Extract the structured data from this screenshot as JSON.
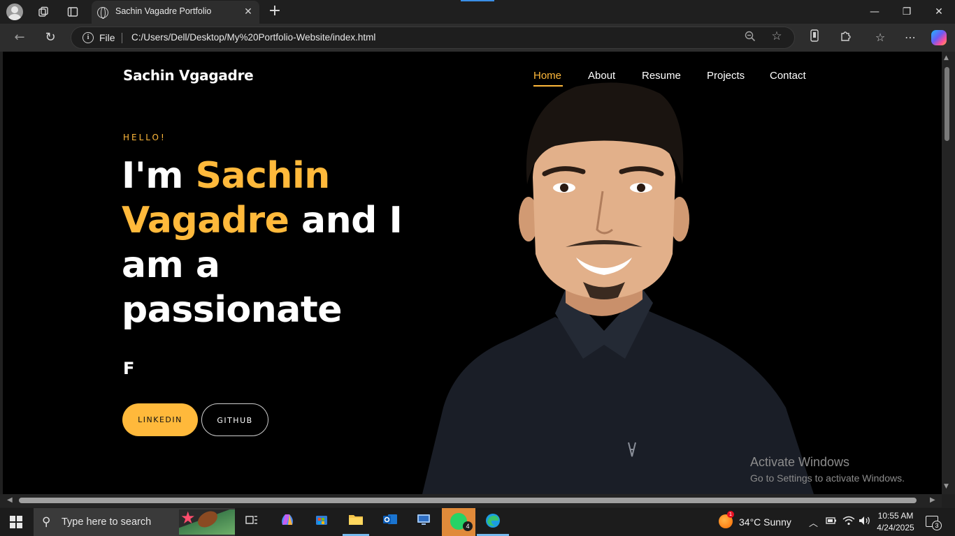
{
  "browser": {
    "tab_title": "Sachin Vagadre Portfolio",
    "file_label": "File",
    "url": "C:/Users/Dell/Desktop/My%20Portfolio-Website/index.html"
  },
  "site": {
    "logo": "Sachin Vgagadre",
    "nav": [
      {
        "label": "Home",
        "active": true
      },
      {
        "label": "About"
      },
      {
        "label": "Resume"
      },
      {
        "label": "Projects"
      },
      {
        "label": "Contact"
      }
    ],
    "hero": {
      "greeting": "HELLO!",
      "intro_prefix": "I'm ",
      "name_highlight": "Sachin Vagadre",
      "intro_suffix": " and I am a passionate",
      "typed_text": "F",
      "buttons": {
        "linkedin": "LINKEDIN",
        "github": "GITHUB"
      }
    },
    "accent_color": "#ffb93b"
  },
  "watermark": {
    "line1": "Activate Windows",
    "line2": "Go to Settings to activate Windows."
  },
  "taskbar": {
    "search_placeholder": "Type here to search",
    "whatsapp_badge": "4",
    "weather": "34°C  Sunny",
    "weather_badge": "1",
    "time": "10:55 AM",
    "date": "4/24/2025",
    "notification_count": "3"
  }
}
